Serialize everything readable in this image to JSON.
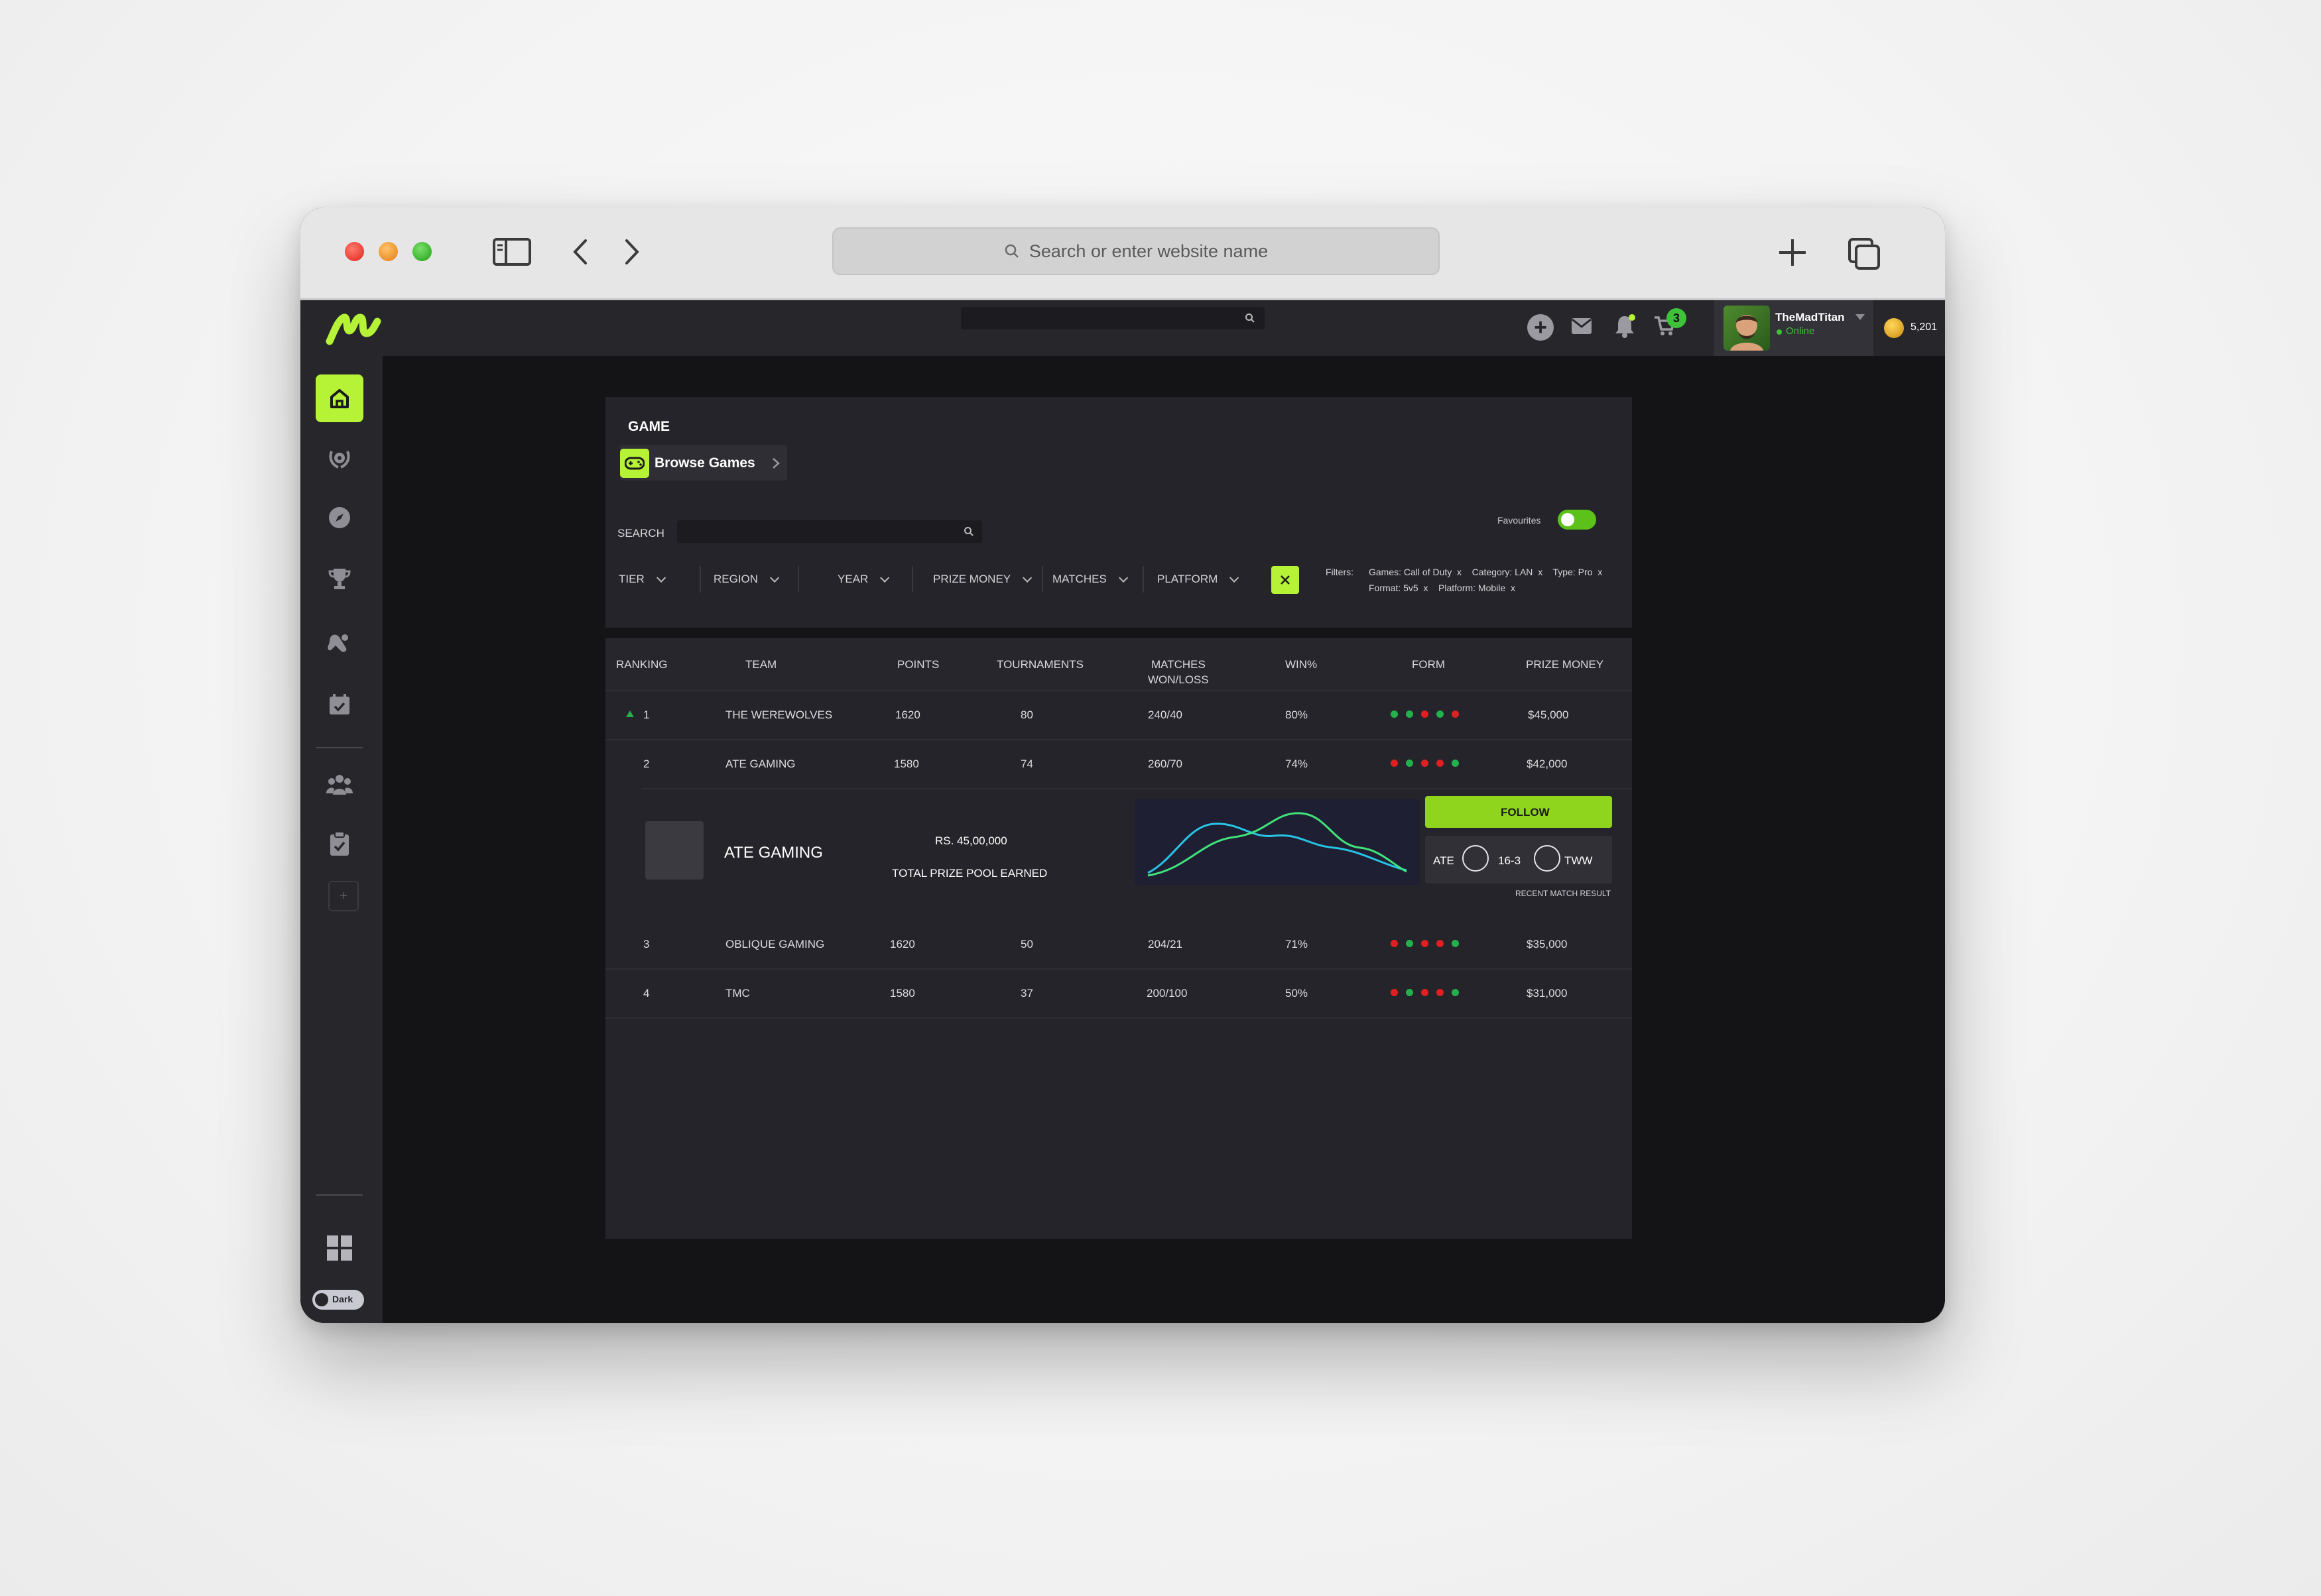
{
  "browser": {
    "url_placeholder": "Search or enter website name"
  },
  "topbar": {
    "cart_count": "3",
    "username": "TheMadTitan",
    "status": "Online",
    "coins": "5,201"
  },
  "sidebar": {
    "theme_toggle": "Dark"
  },
  "page": {
    "section_title": "GAME",
    "breadcrumb": "Browse Games",
    "favourites_label": "Favourites",
    "search_label": "SEARCH",
    "filters": [
      "TIER",
      "REGION",
      "YEAR",
      "PRIZE MONEY",
      "MATCHES",
      "PLATFORM"
    ],
    "applied_filters_label": "Filters:",
    "applied_line1": "Games: Call of Duty  x    Category: LAN  x    Type: Pro  x",
    "applied_line2": "Format: 5v5  x    Platform: Mobile  x"
  },
  "table": {
    "headers": {
      "ranking": "RANKING",
      "team": "TEAM",
      "points": "POINTS",
      "tournaments": "TOURNAMENTS",
      "matches_line1": "MATCHES",
      "matches_line2": "WON/LOSS",
      "win": "WIN%",
      "form": "FORM",
      "prize": "PRIZE MONEY"
    },
    "rows": [
      {
        "rank": "1",
        "team": "THE WEREWOLVES",
        "points": "1620",
        "tournaments": "80",
        "matches": "240/40",
        "win": "80%",
        "prize": "$45,000"
      },
      {
        "rank": "2",
        "team": "ATE GAMING",
        "points": "1580",
        "tournaments": "74",
        "matches": "260/70",
        "win": "74%",
        "prize": "$42,000"
      },
      {
        "rank": "3",
        "team": "OBLIQUE GAMING",
        "points": "1620",
        "tournaments": "50",
        "matches": "204/21",
        "win": "71%",
        "prize": "$35,000"
      },
      {
        "rank": "4",
        "team": "TMC",
        "points": "1580",
        "tournaments": "37",
        "matches": "200/100",
        "win": "50%",
        "prize": "$31,000"
      }
    ],
    "form": [
      [
        "#22b14c",
        "#22b14c",
        "#e02020",
        "#22b14c",
        "#e02020"
      ],
      [
        "#e02020",
        "#22b14c",
        "#e02020",
        "#e02020",
        "#22b14c"
      ],
      [
        "#e02020",
        "#22b14c",
        "#e02020",
        "#e02020",
        "#22b14c"
      ],
      [
        "#e02020",
        "#22b14c",
        "#e02020",
        "#e02020",
        "#22b14c"
      ]
    ]
  },
  "expanded": {
    "team": "ATE GAMING",
    "prize_amount": "RS. 45,00,000",
    "prize_label": "TOTAL PRIZE POOL EARNED",
    "follow": "FOLLOW",
    "result_team1": "ATE",
    "result_score": "16-3",
    "result_team2": "TWW",
    "recent_label": "RECENT MATCH RESULT"
  },
  "colors": {
    "accent": "#b6f236",
    "win": "#22b14c",
    "loss": "#e02020"
  }
}
